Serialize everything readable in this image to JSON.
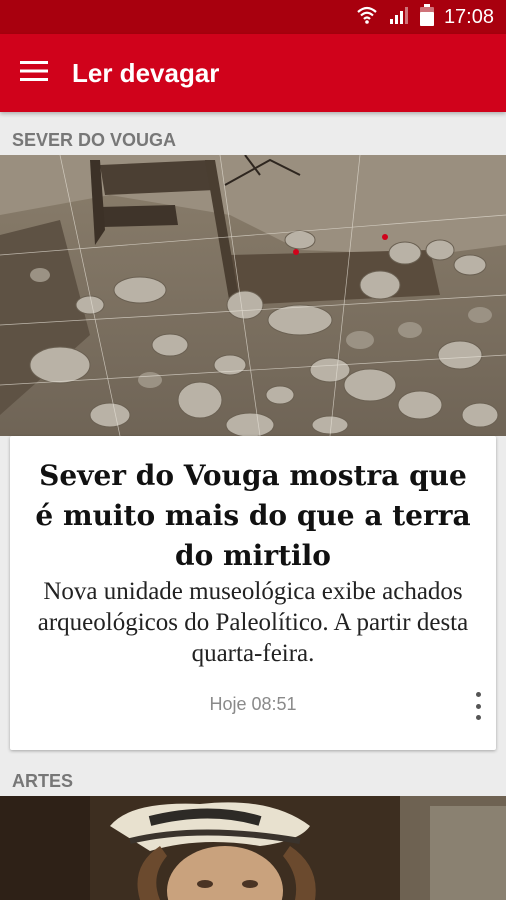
{
  "status_bar": {
    "time": "17:08",
    "icons": [
      "wifi-icon",
      "signal-icon",
      "battery-icon"
    ]
  },
  "app_bar": {
    "title": "Ler devagar",
    "menu_icon": "hamburger-menu-icon",
    "color": "#d0021b"
  },
  "feed": {
    "sections": [
      {
        "label": "SEVER DO VOUGA",
        "article": {
          "title": "Sever do Vouga mostra que é muito mais do que a terra do mirtilo",
          "summary": "Nova unidade museológica exibe achados arqueológicos do Paleolítico. A partir desta quarta-feira.",
          "time": "Hoje 08:51",
          "image": "archaeological-excavation-photo"
        }
      },
      {
        "label": "ARTES",
        "image": "renaissance-portrait-painting"
      }
    ]
  }
}
